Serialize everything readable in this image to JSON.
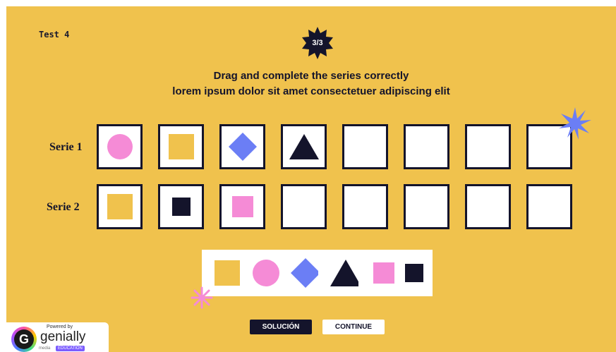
{
  "header": {
    "test_label": "Test 4",
    "progress": "3/3",
    "title_line1": "Drag and complete the series correctly",
    "title_line2": "lorem ipsum dolor sit amet consectetuer adipiscing elit"
  },
  "series": [
    {
      "label": "Serie 1",
      "cells": [
        "pink-circle",
        "yellow-square",
        "blue-diamond",
        "navy-triangle",
        "empty",
        "empty",
        "empty",
        "empty"
      ]
    },
    {
      "label": "Serie 2",
      "cells": [
        "yellow-square",
        "navy-small-square",
        "pink-square",
        "empty",
        "empty",
        "empty",
        "empty",
        "empty"
      ]
    }
  ],
  "tray": [
    "yellow-square",
    "pink-circle",
    "blue-diamond",
    "navy-triangle",
    "pink-square",
    "navy-small-square"
  ],
  "buttons": {
    "solution": "SOLUCIÓN",
    "continue": "CONTINUE"
  },
  "branding": {
    "powered_by": "Powered by",
    "name": "genially",
    "education": "EDUCATION",
    "prefix": "media",
    "logo_letter": "G"
  },
  "colors": {
    "background": "#f0c24d",
    "navy": "#14142b",
    "pink": "#f58bd6",
    "blue": "#6b7ef5",
    "yellow": "#f0c24d"
  }
}
